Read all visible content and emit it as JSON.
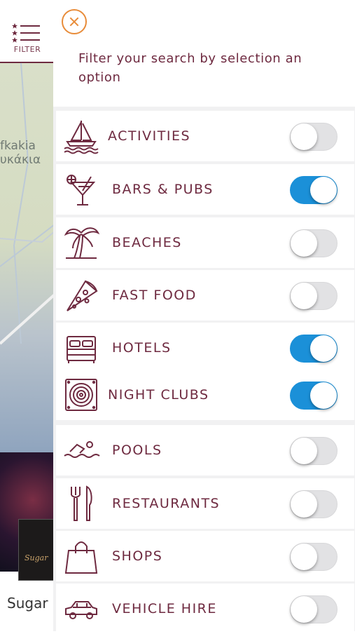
{
  "background": {
    "filter_label": "FILTER",
    "map_labels": [
      "fkakia",
      "υκάκια"
    ],
    "card_logo_text": "Sugar",
    "card_title": "Sugar"
  },
  "panel": {
    "instruction": "Filter your search by selection an option",
    "items": [
      {
        "label": "ACTIVITIES",
        "icon": "sailboat-icon",
        "enabled": false
      },
      {
        "label": "BARS & PUBS",
        "icon": "cocktail-icon",
        "enabled": true
      },
      {
        "label": "BEACHES",
        "icon": "palm-tree-icon",
        "enabled": false
      },
      {
        "label": "FAST FOOD",
        "icon": "pizza-slice-icon",
        "enabled": false
      },
      {
        "label": "HOTELS",
        "icon": "bed-icon",
        "enabled": true
      },
      {
        "label": "NIGHT CLUBS",
        "icon": "speaker-icon",
        "enabled": true
      },
      {
        "label": "POOLS",
        "icon": "swimmer-icon",
        "enabled": false
      },
      {
        "label": "RESTAURANTS",
        "icon": "fork-knife-icon",
        "enabled": false
      },
      {
        "label": "SHOPS",
        "icon": "shopping-bag-icon",
        "enabled": false
      },
      {
        "label": "VEHICLE HIRE",
        "icon": "car-icon",
        "enabled": false
      }
    ]
  },
  "colors": {
    "accent_text": "#6e2a40",
    "close_orange": "#e88c3a",
    "toggle_on": "#1b90d8",
    "toggle_off": "#e2e2e4"
  }
}
